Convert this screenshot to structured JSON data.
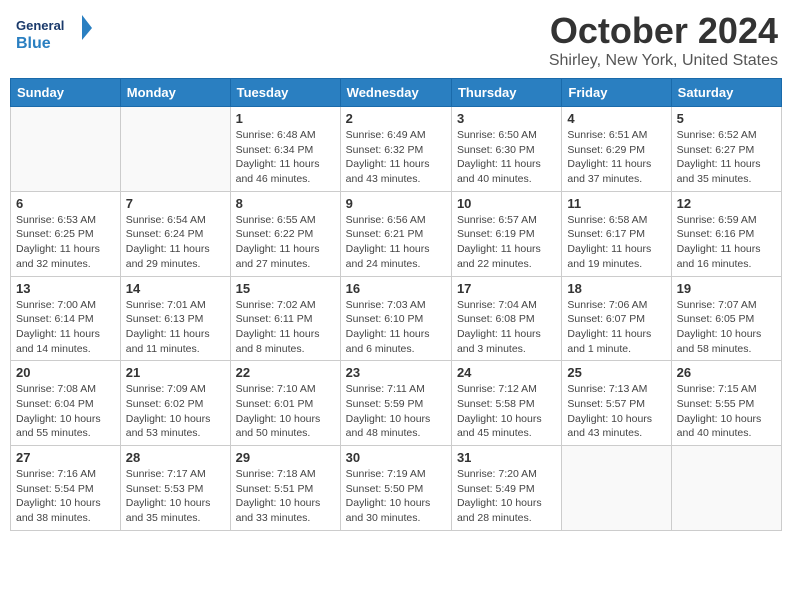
{
  "header": {
    "logo_general": "General",
    "logo_blue": "Blue",
    "month_title": "October 2024",
    "location": "Shirley, New York, United States"
  },
  "days_of_week": [
    "Sunday",
    "Monday",
    "Tuesday",
    "Wednesday",
    "Thursday",
    "Friday",
    "Saturday"
  ],
  "weeks": [
    [
      {
        "day": "",
        "info": ""
      },
      {
        "day": "",
        "info": ""
      },
      {
        "day": "1",
        "info": "Sunrise: 6:48 AM\nSunset: 6:34 PM\nDaylight: 11 hours and 46 minutes."
      },
      {
        "day": "2",
        "info": "Sunrise: 6:49 AM\nSunset: 6:32 PM\nDaylight: 11 hours and 43 minutes."
      },
      {
        "day": "3",
        "info": "Sunrise: 6:50 AM\nSunset: 6:30 PM\nDaylight: 11 hours and 40 minutes."
      },
      {
        "day": "4",
        "info": "Sunrise: 6:51 AM\nSunset: 6:29 PM\nDaylight: 11 hours and 37 minutes."
      },
      {
        "day": "5",
        "info": "Sunrise: 6:52 AM\nSunset: 6:27 PM\nDaylight: 11 hours and 35 minutes."
      }
    ],
    [
      {
        "day": "6",
        "info": "Sunrise: 6:53 AM\nSunset: 6:25 PM\nDaylight: 11 hours and 32 minutes."
      },
      {
        "day": "7",
        "info": "Sunrise: 6:54 AM\nSunset: 6:24 PM\nDaylight: 11 hours and 29 minutes."
      },
      {
        "day": "8",
        "info": "Sunrise: 6:55 AM\nSunset: 6:22 PM\nDaylight: 11 hours and 27 minutes."
      },
      {
        "day": "9",
        "info": "Sunrise: 6:56 AM\nSunset: 6:21 PM\nDaylight: 11 hours and 24 minutes."
      },
      {
        "day": "10",
        "info": "Sunrise: 6:57 AM\nSunset: 6:19 PM\nDaylight: 11 hours and 22 minutes."
      },
      {
        "day": "11",
        "info": "Sunrise: 6:58 AM\nSunset: 6:17 PM\nDaylight: 11 hours and 19 minutes."
      },
      {
        "day": "12",
        "info": "Sunrise: 6:59 AM\nSunset: 6:16 PM\nDaylight: 11 hours and 16 minutes."
      }
    ],
    [
      {
        "day": "13",
        "info": "Sunrise: 7:00 AM\nSunset: 6:14 PM\nDaylight: 11 hours and 14 minutes."
      },
      {
        "day": "14",
        "info": "Sunrise: 7:01 AM\nSunset: 6:13 PM\nDaylight: 11 hours and 11 minutes."
      },
      {
        "day": "15",
        "info": "Sunrise: 7:02 AM\nSunset: 6:11 PM\nDaylight: 11 hours and 8 minutes."
      },
      {
        "day": "16",
        "info": "Sunrise: 7:03 AM\nSunset: 6:10 PM\nDaylight: 11 hours and 6 minutes."
      },
      {
        "day": "17",
        "info": "Sunrise: 7:04 AM\nSunset: 6:08 PM\nDaylight: 11 hours and 3 minutes."
      },
      {
        "day": "18",
        "info": "Sunrise: 7:06 AM\nSunset: 6:07 PM\nDaylight: 11 hours and 1 minute."
      },
      {
        "day": "19",
        "info": "Sunrise: 7:07 AM\nSunset: 6:05 PM\nDaylight: 10 hours and 58 minutes."
      }
    ],
    [
      {
        "day": "20",
        "info": "Sunrise: 7:08 AM\nSunset: 6:04 PM\nDaylight: 10 hours and 55 minutes."
      },
      {
        "day": "21",
        "info": "Sunrise: 7:09 AM\nSunset: 6:02 PM\nDaylight: 10 hours and 53 minutes."
      },
      {
        "day": "22",
        "info": "Sunrise: 7:10 AM\nSunset: 6:01 PM\nDaylight: 10 hours and 50 minutes."
      },
      {
        "day": "23",
        "info": "Sunrise: 7:11 AM\nSunset: 5:59 PM\nDaylight: 10 hours and 48 minutes."
      },
      {
        "day": "24",
        "info": "Sunrise: 7:12 AM\nSunset: 5:58 PM\nDaylight: 10 hours and 45 minutes."
      },
      {
        "day": "25",
        "info": "Sunrise: 7:13 AM\nSunset: 5:57 PM\nDaylight: 10 hours and 43 minutes."
      },
      {
        "day": "26",
        "info": "Sunrise: 7:15 AM\nSunset: 5:55 PM\nDaylight: 10 hours and 40 minutes."
      }
    ],
    [
      {
        "day": "27",
        "info": "Sunrise: 7:16 AM\nSunset: 5:54 PM\nDaylight: 10 hours and 38 minutes."
      },
      {
        "day": "28",
        "info": "Sunrise: 7:17 AM\nSunset: 5:53 PM\nDaylight: 10 hours and 35 minutes."
      },
      {
        "day": "29",
        "info": "Sunrise: 7:18 AM\nSunset: 5:51 PM\nDaylight: 10 hours and 33 minutes."
      },
      {
        "day": "30",
        "info": "Sunrise: 7:19 AM\nSunset: 5:50 PM\nDaylight: 10 hours and 30 minutes."
      },
      {
        "day": "31",
        "info": "Sunrise: 7:20 AM\nSunset: 5:49 PM\nDaylight: 10 hours and 28 minutes."
      },
      {
        "day": "",
        "info": ""
      },
      {
        "day": "",
        "info": ""
      }
    ]
  ]
}
